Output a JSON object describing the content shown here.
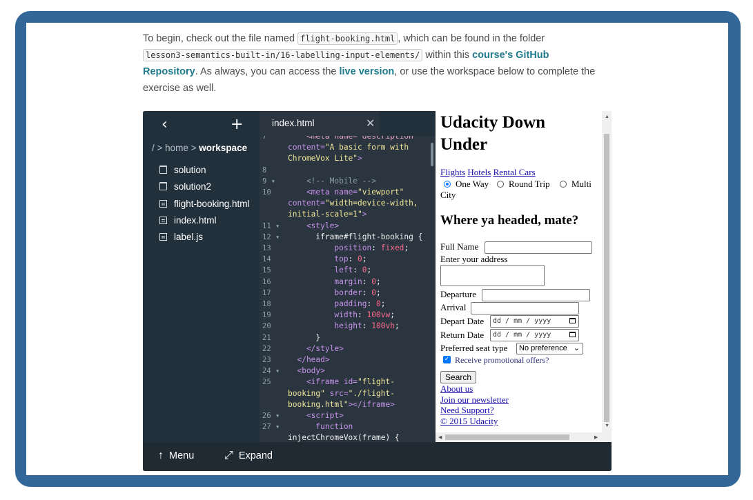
{
  "intro": {
    "part1": "To begin, check out the file named ",
    "code1": "flight-booking.html",
    "part2": ", which can be found in the folder",
    "code2": "lesson3-semantics-built-in/16-labelling-input-elements/",
    "part3": " within this ",
    "link1": "course's GitHub Repository",
    "part4": ". As always, you can access the ",
    "link2": "live version",
    "part5": ", or use the workspace below to complete the exercise as well."
  },
  "sidebar": {
    "back_icon": "chevron-left-icon",
    "add_icon": "plus-icon",
    "breadcrumb_prefix": "/ > home > ",
    "breadcrumb_current": "workspace",
    "items": [
      {
        "label": "solution",
        "icon": "folder-icon"
      },
      {
        "label": "solution2",
        "icon": "folder-icon"
      },
      {
        "label": "flight-booking.html",
        "icon": "file-icon"
      },
      {
        "label": "index.html",
        "icon": "file-icon"
      },
      {
        "label": "label.js",
        "icon": "file-icon"
      }
    ]
  },
  "editor": {
    "tab_label": "index.html",
    "close_symbol": "✕",
    "lines": [
      {
        "num": "7",
        "segs": [
          {
            "t": "    <meta name=\"description\"",
            "c": "#e8a8c8"
          }
        ]
      },
      {
        "num": "",
        "segs": [
          {
            "t": "content=",
            "c": "#c792ea"
          },
          {
            "t": "\"A basic form with",
            "c": "#f2e79a"
          }
        ]
      },
      {
        "num": "",
        "segs": [
          {
            "t": "ChromeVox Lite\"",
            "c": "#f2e79a"
          },
          {
            "t": ">",
            "c": "#c792ea"
          }
        ]
      },
      {
        "num": "8",
        "segs": [
          {
            "t": "",
            "c": "#f0f0f0"
          }
        ]
      },
      {
        "num": "9 ▾",
        "segs": [
          {
            "t": "    <!-- Mobile -->",
            "c": "#8e9aa6"
          }
        ]
      },
      {
        "num": "10",
        "segs": [
          {
            "t": "    <meta ",
            "c": "#c792ea"
          },
          {
            "t": "name=",
            "c": "#c792ea"
          },
          {
            "t": "\"viewport\"",
            "c": "#f2e79a"
          }
        ]
      },
      {
        "num": "",
        "segs": [
          {
            "t": "content=",
            "c": "#c792ea"
          },
          {
            "t": "\"width=device-width,",
            "c": "#f2e79a"
          }
        ]
      },
      {
        "num": "",
        "segs": [
          {
            "t": "initial-scale=1\"",
            "c": "#f2e79a"
          },
          {
            "t": ">",
            "c": "#c792ea"
          }
        ]
      },
      {
        "num": "11 ▾",
        "segs": [
          {
            "t": "    <style>",
            "c": "#c792ea"
          }
        ]
      },
      {
        "num": "12 ▾",
        "segs": [
          {
            "t": "      iframe#flight-booking {",
            "c": "#f0f0f0"
          }
        ]
      },
      {
        "num": "13",
        "segs": [
          {
            "t": "          position",
            "c": "#c792ea"
          },
          {
            "t": ": ",
            "c": "#f0f0f0"
          },
          {
            "t": "fixed",
            "c": "#ff6b8b"
          },
          {
            "t": ";",
            "c": "#f0f0f0"
          }
        ]
      },
      {
        "num": "14",
        "segs": [
          {
            "t": "          top",
            "c": "#c792ea"
          },
          {
            "t": ": ",
            "c": "#f0f0f0"
          },
          {
            "t": "0",
            "c": "#ff6b8b"
          },
          {
            "t": ";",
            "c": "#f0f0f0"
          }
        ]
      },
      {
        "num": "15",
        "segs": [
          {
            "t": "          left",
            "c": "#c792ea"
          },
          {
            "t": ": ",
            "c": "#f0f0f0"
          },
          {
            "t": "0",
            "c": "#ff6b8b"
          },
          {
            "t": ";",
            "c": "#f0f0f0"
          }
        ]
      },
      {
        "num": "16",
        "segs": [
          {
            "t": "          margin",
            "c": "#c792ea"
          },
          {
            "t": ": ",
            "c": "#f0f0f0"
          },
          {
            "t": "0",
            "c": "#ff6b8b"
          },
          {
            "t": ";",
            "c": "#f0f0f0"
          }
        ]
      },
      {
        "num": "17",
        "segs": [
          {
            "t": "          border",
            "c": "#c792ea"
          },
          {
            "t": ": ",
            "c": "#f0f0f0"
          },
          {
            "t": "0",
            "c": "#ff6b8b"
          },
          {
            "t": ";",
            "c": "#f0f0f0"
          }
        ]
      },
      {
        "num": "18",
        "segs": [
          {
            "t": "          padding",
            "c": "#c792ea"
          },
          {
            "t": ": ",
            "c": "#f0f0f0"
          },
          {
            "t": "0",
            "c": "#ff6b8b"
          },
          {
            "t": ";",
            "c": "#f0f0f0"
          }
        ]
      },
      {
        "num": "19",
        "segs": [
          {
            "t": "          width",
            "c": "#c792ea"
          },
          {
            "t": ": ",
            "c": "#f0f0f0"
          },
          {
            "t": "100vw",
            "c": "#ff6b8b"
          },
          {
            "t": ";",
            "c": "#f0f0f0"
          }
        ]
      },
      {
        "num": "20",
        "segs": [
          {
            "t": "          height",
            "c": "#c792ea"
          },
          {
            "t": ": ",
            "c": "#f0f0f0"
          },
          {
            "t": "100vh",
            "c": "#ff6b8b"
          },
          {
            "t": ";",
            "c": "#f0f0f0"
          }
        ]
      },
      {
        "num": "21",
        "segs": [
          {
            "t": "      }",
            "c": "#f0f0f0"
          }
        ]
      },
      {
        "num": "22",
        "segs": [
          {
            "t": "    </style>",
            "c": "#c792ea"
          }
        ]
      },
      {
        "num": "23",
        "segs": [
          {
            "t": "  </head>",
            "c": "#c792ea"
          }
        ]
      },
      {
        "num": "24 ▾",
        "segs": [
          {
            "t": "  <body>",
            "c": "#c792ea"
          }
        ]
      },
      {
        "num": "25",
        "segs": [
          {
            "t": "    <iframe ",
            "c": "#c792ea"
          },
          {
            "t": "id=",
            "c": "#c792ea"
          },
          {
            "t": "\"flight-",
            "c": "#f2e79a"
          }
        ]
      },
      {
        "num": "",
        "segs": [
          {
            "t": "booking\" ",
            "c": "#f2e79a"
          },
          {
            "t": "src=",
            "c": "#c792ea"
          },
          {
            "t": "\"./flight-",
            "c": "#f2e79a"
          }
        ]
      },
      {
        "num": "",
        "segs": [
          {
            "t": "booking.html\"",
            "c": "#f2e79a"
          },
          {
            "t": "></iframe>",
            "c": "#c792ea"
          }
        ]
      },
      {
        "num": "26 ▾",
        "segs": [
          {
            "t": "    <script>",
            "c": "#c792ea"
          }
        ]
      },
      {
        "num": "27 ▾",
        "segs": [
          {
            "t": "      function",
            "c": "#c792ea"
          }
        ]
      },
      {
        "num": "",
        "segs": [
          {
            "t": "injectChromeVox(frame) {",
            "c": "#f0f0f0"
          }
        ]
      }
    ]
  },
  "preview": {
    "title_line1": "Udacity Down",
    "title_line2": "Under",
    "nav": [
      "Flights",
      "Hotels",
      "Rental Cars"
    ],
    "trip": {
      "one_way": "One Way",
      "round_trip": "Round Trip",
      "multi": "Multi",
      "city": "City",
      "selected": "One Way"
    },
    "heading": "Where ya headed, mate?",
    "labels": {
      "full_name": "Full Name",
      "address": "Enter your address",
      "departure": "Departure",
      "arrival": "Arrival",
      "depart_date": "Depart Date",
      "return_date": "Return Date",
      "seat": "Preferred seat type",
      "promo": "Receive promotional offers?"
    },
    "date_placeholder": "dd / mm / yyyy",
    "seat_value": "No preference",
    "promo_checked": true,
    "search_label": "Search",
    "footer_links": [
      "About us",
      "Join our newsletter",
      "Need Support?",
      "© 2015 Udacity"
    ]
  },
  "bottombar": {
    "menu_label": "Menu",
    "expand_label": "Expand"
  }
}
